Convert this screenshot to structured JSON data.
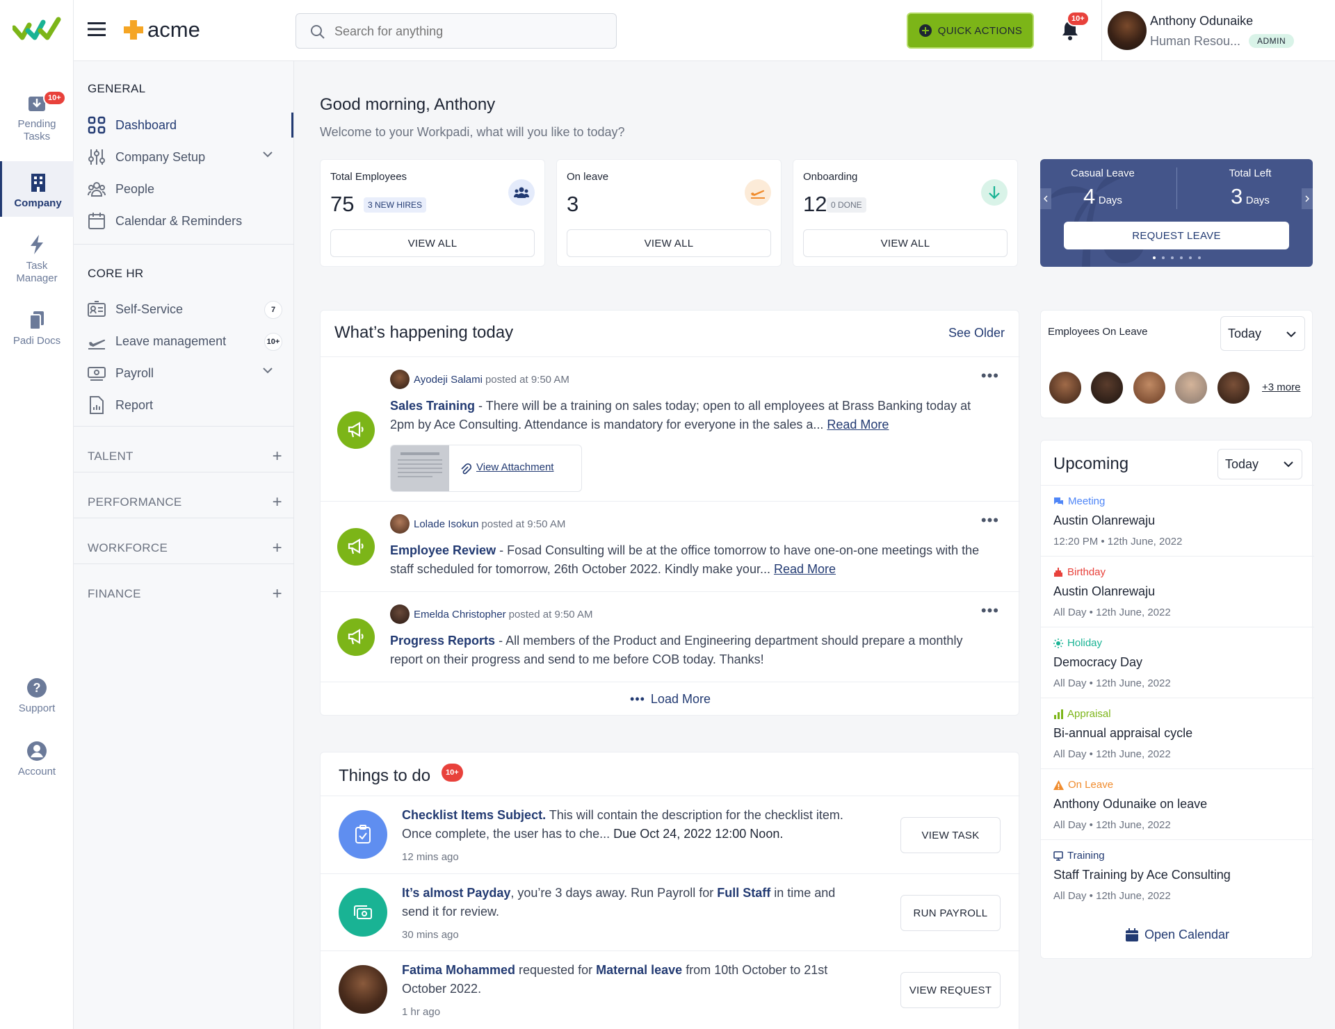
{
  "rail": {
    "pending_label_1": "Pending",
    "pending_label_2": "Tasks",
    "pending_badge": "10+",
    "company": "Company",
    "task_1": "Task",
    "task_2": "Manager",
    "padi_docs": "Padi Docs",
    "support": "Support",
    "account": "Account"
  },
  "topbar": {
    "brand": "acme",
    "search_placeholder": "Search for anything",
    "quick_actions": "QUICK ACTIONS",
    "notif_badge": "10+",
    "user_name": "Anthony Odunaike",
    "user_role": "Human Resou...",
    "user_badge": "ADMIN"
  },
  "sidebar": {
    "general": "GENERAL",
    "items_general": [
      "Dashboard",
      "Company Setup",
      "People",
      "Calendar & Reminders"
    ],
    "core_hr": "CORE HR",
    "items_core": [
      "Self-Service",
      "Leave management",
      "Payroll",
      "Report"
    ],
    "self_service_count": "7",
    "leave_count": "10+",
    "sections": [
      "TALENT",
      "PERFORMANCE",
      "WORKFORCE",
      "FINANCE"
    ]
  },
  "greeting": {
    "title": "Good morning, Anthony",
    "subtitle": "Welcome to your Workpadi, what will you like to today?"
  },
  "stats": [
    {
      "title": "Total Employees",
      "value": "75",
      "tag": "3 NEW HIRES",
      "button": "VIEW ALL"
    },
    {
      "title": "On leave",
      "value": "3",
      "tag": "",
      "button": "VIEW ALL"
    },
    {
      "title": "Onboarding",
      "value": "12",
      "tag": "0 DONE",
      "button": "VIEW ALL"
    }
  ],
  "leave_card": {
    "casual_label": "Casual Leave",
    "casual_value": "4",
    "left_label": "Total Left",
    "left_value": "3",
    "unit": "Days",
    "button": "REQUEST LEAVE"
  },
  "feed": {
    "title": "What’s happening today",
    "see_older": "See Older",
    "posts": [
      {
        "author": "Ayodeji Salami",
        "meta": "posted at 9:50 AM",
        "subject": "Sales Training",
        "body": " - There will be a training on sales today; open to all employees at Brass Banking today at 2pm by Ace Consulting. Attendance is mandatory for everyone in the sales a... ",
        "read_more": "Read More"
      },
      {
        "author": "Lolade Isokun",
        "meta": "posted at 9:50 AM",
        "subject": "Employee Review",
        "body": " - Fosad Consulting will be at the office tomorrow to have one-on-one meetings with the staff scheduled for tomorrow, 26th October 2022. Kindly make your... ",
        "read_more": "Read More"
      },
      {
        "author": "Emelda Christopher",
        "meta": "posted at 9:50 AM",
        "subject": "Progress Reports",
        "body": " - All members of the Product and Engineering department should prepare a monthly report on their progress and send to me before COB today. Thanks!",
        "read_more": ""
      }
    ],
    "attachment": "View Attachment",
    "load_more": "Load More"
  },
  "todo": {
    "title": "Things to do",
    "badge": "10+",
    "items": [
      {
        "p1": "Checklist Items Subject.",
        "p2": " This will contain the description for the checklist item. Once complete, the user has to che... ",
        "p3": "Due Oct 24, 2022 12:00 Noon.",
        "p4": "",
        "p5": "",
        "time": "12 mins ago",
        "button": "VIEW TASK"
      },
      {
        "p1": "It’s almost Payday",
        "p2": ", you’re 3 days away. Run Payroll for ",
        "p3": "Full Staff",
        "p4": " in time and send it for review.",
        "p5": "",
        "time": "30 mins ago",
        "button": "RUN PAYROLL"
      },
      {
        "p1": "Fatima Mohammed",
        "p2": " requested for ",
        "p3": "Maternal leave",
        "p4": " from 10th October to 21st October 2022.",
        "p5": "",
        "time": "1 hr ago",
        "button": "VIEW REQUEST"
      }
    ]
  },
  "on_leave": {
    "title": "Employees On Leave",
    "filter": "Today",
    "more": "+3 more"
  },
  "upcoming": {
    "title": "Upcoming",
    "filter": "Today",
    "items": [
      {
        "type": "Meeting",
        "name": "Austin Olanrewaju",
        "time": "12:20 PM • 12th June, 2022",
        "color": "#4f86f7"
      },
      {
        "type": "Birthday",
        "name": "Austin Olanrewaju",
        "time": "All Day • 12th June, 2022",
        "color": "#e8413b"
      },
      {
        "type": "Holiday",
        "name": "Democracy Day",
        "time": "All Day • 12th June, 2022",
        "color": "#19b394"
      },
      {
        "type": "Appraisal",
        "name": "Bi-annual appraisal cycle",
        "time": "All Day • 12th June, 2022",
        "color": "#7cb518"
      },
      {
        "type": "On Leave",
        "name": "Anthony Odunaike on leave",
        "time": "All Day • 12th June, 2022",
        "color": "#f08c2e"
      },
      {
        "type": "Training",
        "name": "Staff Training by Ace Consulting",
        "time": "All Day • 12th June, 2022",
        "color": "#223a72"
      }
    ],
    "open_calendar": "Open Calendar"
  }
}
